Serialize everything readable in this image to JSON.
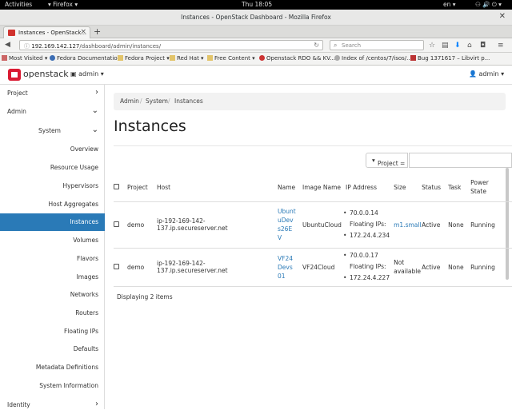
{
  "system_bar": {
    "activities": "Activities",
    "app": "Firefox",
    "clock": "Thu 18:05",
    "lang": "en"
  },
  "window": {
    "title": "Instances - OpenStack Dashboard - Mozilla Firefox"
  },
  "tab": {
    "label": "Instances - OpenStack..."
  },
  "url": {
    "host": "192.169.142.127",
    "path": "/dashboard/admin/instances/"
  },
  "search": {
    "placeholder": "Search"
  },
  "bookmarks": [
    "Most Visited",
    "Fedora Documentation",
    "Fedora Project",
    "Red Hat",
    "Free Content",
    "Openstack RDO && KV...",
    "Index of /centos/7/isos/...",
    "Bug 1371617 – Libvirt p..."
  ],
  "header": {
    "brand": "openstack",
    "project": "admin",
    "user": "admin"
  },
  "sidebar": {
    "project": "Project",
    "admin": "Admin",
    "system": "System",
    "items": [
      "Overview",
      "Resource Usage",
      "Hypervisors",
      "Host Aggregates",
      "Instances",
      "Volumes",
      "Flavors",
      "Images",
      "Networks",
      "Routers",
      "Floating IPs",
      "Defaults",
      "Metadata Definitions",
      "System Information"
    ],
    "identity": "Identity"
  },
  "breadcrumb": [
    "Admin",
    "System",
    "Instances"
  ],
  "page_title": "Instances",
  "filter": {
    "dropdown": "Project ="
  },
  "table": {
    "headers": {
      "project": "Project",
      "host": "Host",
      "name": "Name",
      "image": "Image Name",
      "ip": "IP Address",
      "size": "Size",
      "status": "Status",
      "task": "Task",
      "power": "Power State"
    },
    "rows": [
      {
        "project": "demo",
        "host": "ip-192-169-142-137.ip.secureserver.net",
        "name": "UbuntuDevs26EV",
        "name_lines": [
          "Ubunt",
          "uDev",
          "s26E",
          "V"
        ],
        "image": "UbuntuCloud",
        "ip1": "70.0.0.14",
        "ip_label": "Floating IPs:",
        "ip2": "172.24.4.234",
        "size": "m1.small",
        "status": "Active",
        "task": "None",
        "power": "Running"
      },
      {
        "project": "demo",
        "host": "ip-192-169-142-137.ip.secureserver.net",
        "name": "VF24Devs01",
        "name_lines": [
          "VF24",
          "Devs",
          "01"
        ],
        "image": "VF24Cloud",
        "ip1": "70.0.0.17",
        "ip_label": "Floating IPs:",
        "ip2": "172.24.4.227",
        "size": "Not available",
        "size_lines": [
          "Not",
          "available"
        ],
        "status": "Active",
        "task": "None",
        "power": "Running"
      }
    ]
  },
  "footer": "Displaying 2 items",
  "colors": {
    "accent": "#2a7ab7",
    "brand_red": "#da1a32"
  }
}
